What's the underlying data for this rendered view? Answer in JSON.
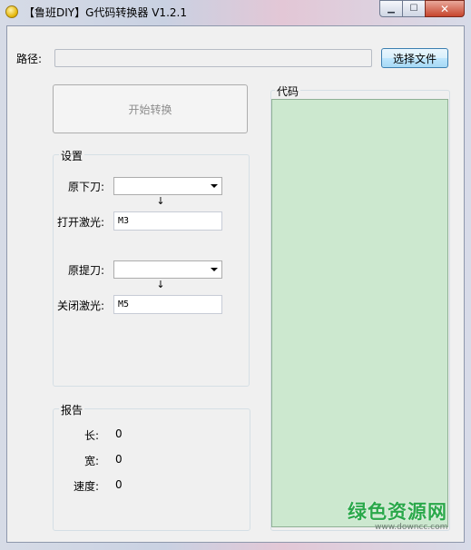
{
  "window": {
    "title": "【鲁班DIY】G代码转换器 V1.2.1",
    "controls": {
      "minimize": "▁",
      "maximize": "☐",
      "close": "✕"
    }
  },
  "path": {
    "label": "路径:",
    "value": "",
    "browse_button": "选择文件"
  },
  "convert_button": "开始转换",
  "settings": {
    "legend": "设置",
    "orig_down_label": "原下刀:",
    "orig_down_value": "",
    "arrow": "↓",
    "laser_on_label": "打开激光:",
    "laser_on_value": "M3",
    "orig_up_label": "原提刀:",
    "orig_up_value": "",
    "laser_off_label": "关闭激光:",
    "laser_off_value": "M5"
  },
  "report": {
    "legend": "报告",
    "length_label": "长:",
    "length_value": "0",
    "width_label": "宽:",
    "width_value": "0",
    "speed_label": "速度:",
    "speed_value": "0"
  },
  "code": {
    "legend": "代码",
    "content": ""
  },
  "watermark": {
    "main": "绿色资源网",
    "sub": "www.downcc.com"
  },
  "colors": {
    "code_bg": "#cce8cf",
    "watermark": "#2aa84a"
  }
}
